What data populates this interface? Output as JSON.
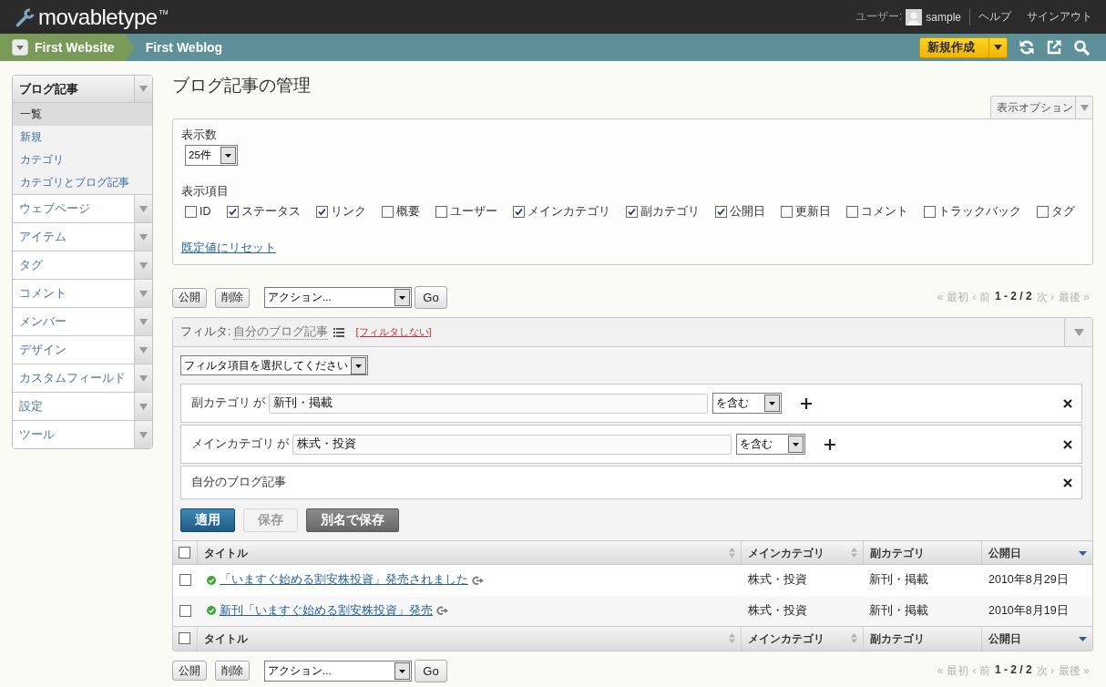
{
  "header": {
    "logo": "movabletype",
    "logo_mark": "TM",
    "user_label": "ユーザー:",
    "user_name": "sample",
    "links": [
      "ヘルプ",
      "サインアウト"
    ]
  },
  "nav": {
    "website": "First Website",
    "blog": "First Weblog",
    "new_button": "新規作成"
  },
  "sidebar": {
    "items": [
      {
        "label": "ブログ記事",
        "expanded": true,
        "children": [
          {
            "label": "一覧",
            "selected": true
          },
          {
            "label": "新規",
            "selected": false
          },
          {
            "label": "カテゴリ",
            "selected": false
          },
          {
            "label": "カテゴリとブログ記事",
            "selected": false
          }
        ]
      },
      {
        "label": "ウェブページ",
        "expanded": false
      },
      {
        "label": "アイテム",
        "expanded": false
      },
      {
        "label": "タグ",
        "expanded": false
      },
      {
        "label": "コメント",
        "expanded": false
      },
      {
        "label": "メンバー",
        "expanded": false
      },
      {
        "label": "デザイン",
        "expanded": false
      },
      {
        "label": "カスタムフィールド",
        "expanded": false
      },
      {
        "label": "設定",
        "expanded": false
      },
      {
        "label": "ツール",
        "expanded": false
      }
    ]
  },
  "page": {
    "title": "ブログ記事の管理"
  },
  "options": {
    "tab": "表示オプション",
    "count_label": "表示数",
    "count_value": "25件",
    "columns_label": "表示項目",
    "columns": [
      {
        "label": "ID",
        "checked": false
      },
      {
        "label": "ステータス",
        "checked": true
      },
      {
        "label": "リンク",
        "checked": true
      },
      {
        "label": "概要",
        "checked": false
      },
      {
        "label": "ユーザー",
        "checked": false
      },
      {
        "label": "メインカテゴリ",
        "checked": true
      },
      {
        "label": "副カテゴリ",
        "checked": true
      },
      {
        "label": "公開日",
        "checked": true
      },
      {
        "label": "更新日",
        "checked": false
      },
      {
        "label": "コメント",
        "checked": false
      },
      {
        "label": "トラックバック",
        "checked": false
      },
      {
        "label": "タグ",
        "checked": false
      }
    ],
    "reset_link": "既定値にリセット"
  },
  "actions_top": {
    "buttons": [
      "公開",
      "削除"
    ],
    "action_select": "アクション...",
    "go": "Go",
    "pagination": {
      "first": {
        "label": "« 最初",
        "disabled": true
      },
      "prev": {
        "label": "‹ 前",
        "disabled": true
      },
      "range": "1 - 2 / 2",
      "next": {
        "label": "次 ›",
        "disabled": true
      },
      "last": {
        "label": "最後 »",
        "disabled": true
      }
    }
  },
  "filter": {
    "label": "フィルタ:",
    "name": "自分のブログ記事",
    "clear_link": "[フィルタしない]",
    "item_select": "フィルタ項目を選択してください",
    "conditions": [
      {
        "kind": "field",
        "label": "副カテゴリ が",
        "value": "新刊・掲載",
        "operator": "を含む"
      },
      {
        "kind": "field",
        "label": "メインカテゴリ が",
        "value": "株式・投資",
        "operator": "を含む"
      },
      {
        "kind": "plain",
        "label": "自分のブログ記事"
      }
    ],
    "buttons": [
      {
        "label": "適用",
        "kind": "primary",
        "disabled": false
      },
      {
        "label": "保存",
        "kind": "plain",
        "disabled": true
      },
      {
        "label": "別名で保存",
        "kind": "secondary",
        "disabled": false
      }
    ]
  },
  "table": {
    "header": {
      "select_all_checked": false,
      "columns": [
        {
          "label": "タイトル",
          "sortable": true,
          "sorted": false
        },
        {
          "label": "メインカテゴリ",
          "sortable": true,
          "sorted": false
        },
        {
          "label": "副カテゴリ",
          "sortable": false,
          "sorted": false
        },
        {
          "label": "公開日",
          "sortable": true,
          "sorted": true
        }
      ]
    },
    "rows": [
      {
        "checked": false,
        "published": true,
        "title": "「いますぐ始める割安株投資」発売されました",
        "main_category": "株式・投資",
        "sub_category": "新刊・掲載",
        "date": "2010年8月29日"
      },
      {
        "checked": false,
        "published": true,
        "title": "新刊「いますぐ始める割安株投資」発売",
        "main_category": "株式・投資",
        "sub_category": "新刊・掲載",
        "date": "2010年8月19日"
      }
    ],
    "footer": {
      "select_all_checked": false,
      "columns": [
        {
          "label": "タイトル",
          "sortable": true,
          "sorted": false
        },
        {
          "label": "メインカテゴリ",
          "sortable": true,
          "sorted": false
        },
        {
          "label": "副カテゴリ",
          "sortable": false,
          "sorted": false
        },
        {
          "label": "公開日",
          "sortable": true,
          "sorted": true
        }
      ]
    }
  },
  "actions_bottom": {
    "buttons": [
      "公開",
      "削除"
    ],
    "action_select": "アクション...",
    "go": "Go",
    "pagination": {
      "first": {
        "label": "« 最初",
        "disabled": true
      },
      "prev": {
        "label": "‹ 前",
        "disabled": true
      },
      "range": "1 - 2 / 2",
      "next": {
        "label": "次 ›",
        "disabled": true
      },
      "last": {
        "label": "最後 »",
        "disabled": true
      }
    }
  }
}
